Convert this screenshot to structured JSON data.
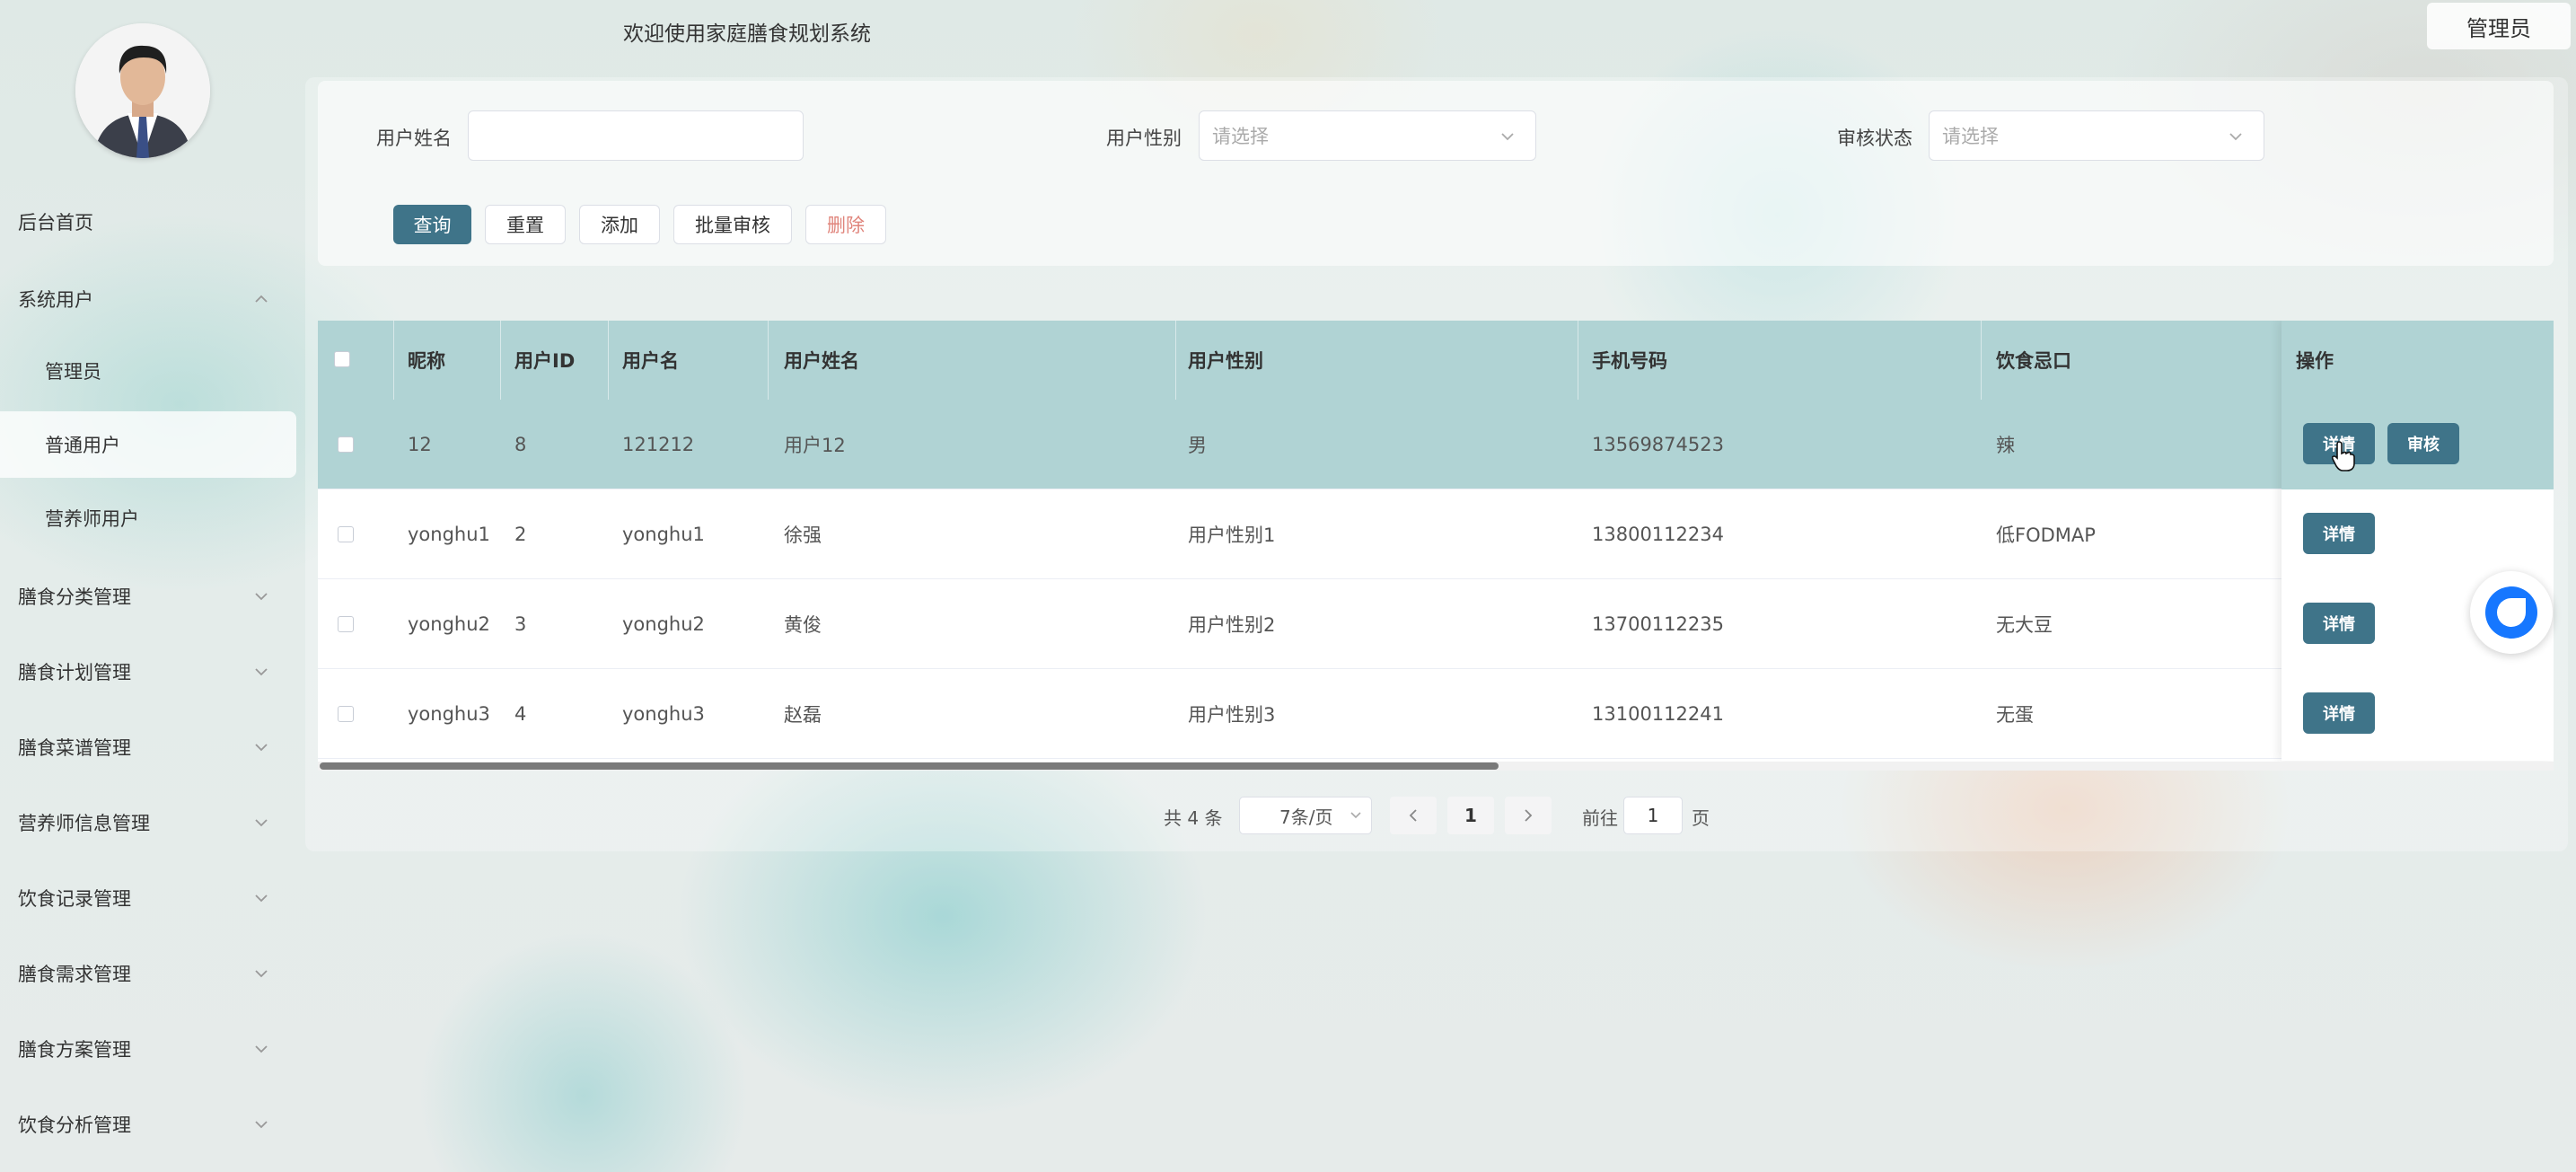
{
  "header": {
    "site_title": "欢迎使用家庭膳食规划系统",
    "user_button": "管理员"
  },
  "sidebar": {
    "items": [
      {
        "label": "后台首页"
      },
      {
        "label": "系统用户"
      },
      {
        "label": "管理员"
      },
      {
        "label": "普通用户",
        "active": true
      },
      {
        "label": "营养师用户"
      },
      {
        "label": "膳食分类管理"
      },
      {
        "label": "膳食计划管理"
      },
      {
        "label": "膳食菜谱管理"
      },
      {
        "label": "营养师信息管理"
      },
      {
        "label": "饮食记录管理"
      },
      {
        "label": "膳食需求管理"
      },
      {
        "label": "膳食方案管理"
      },
      {
        "label": "饮食分析管理"
      }
    ]
  },
  "search": {
    "name_label": "用户姓名",
    "name_value": "",
    "gender_label": "用户性别",
    "gender_placeholder": "请选择",
    "audit_label": "审核状态",
    "audit_placeholder": "请选择"
  },
  "toolbar": {
    "query": "查询",
    "reset": "重置",
    "add": "添加",
    "batch_audit": "批量审核",
    "delete": "删除"
  },
  "table": {
    "columns": [
      "昵称",
      "用户ID",
      "用户名",
      "用户姓名",
      "用户性别",
      "手机号码",
      "饮食忌口",
      "操作"
    ],
    "rows": [
      {
        "nickname": "12",
        "id": "8",
        "username": "121212",
        "name": "用户12",
        "gender": "男",
        "phone": "13569874523",
        "restriction": "辣"
      },
      {
        "nickname": "yonghu1",
        "id": "2",
        "username": "yonghu1",
        "name": "徐强",
        "gender": "用户性别1",
        "phone": "13800112234",
        "restriction": "低FODMAP"
      },
      {
        "nickname": "yonghu2",
        "id": "3",
        "username": "yonghu2",
        "name": "黄俊",
        "gender": "用户性别2",
        "phone": "13700112235",
        "restriction": "无大豆"
      },
      {
        "nickname": "yonghu3",
        "id": "4",
        "username": "yonghu3",
        "name": "赵磊",
        "gender": "用户性别3",
        "phone": "13100112241",
        "restriction": "无蛋"
      }
    ],
    "detail_label": "详情",
    "audit_label": "审核"
  },
  "pagination": {
    "total": "共 4 条",
    "page_size": "7条/页",
    "current_page": "1",
    "goto_label": "前往",
    "goto_value": "1",
    "page_suffix": "页"
  },
  "colors": {
    "primary": "#3f7489",
    "table_header": "#b0d3d4",
    "danger_text": "#e0857c",
    "widget": "#1677ff"
  }
}
